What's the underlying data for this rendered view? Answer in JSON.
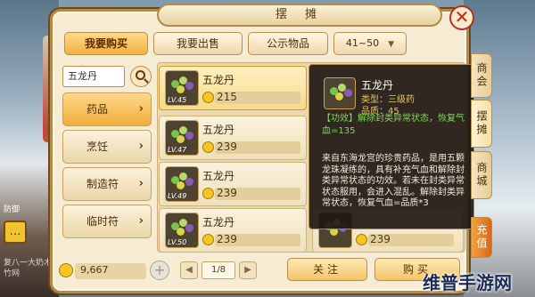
{
  "window": {
    "title": "摆 摊",
    "close_icon": "close-icon"
  },
  "tabs": [
    {
      "label": "我要购买",
      "active": true
    },
    {
      "label": "我要出售",
      "active": false
    },
    {
      "label": "公示物品",
      "active": false
    }
  ],
  "level_filter": {
    "value": "41~50"
  },
  "search": {
    "value": "五龙丹"
  },
  "categories": [
    {
      "label": "药品",
      "active": true
    },
    {
      "label": "烹饪",
      "active": false
    },
    {
      "label": "制造符",
      "active": false
    },
    {
      "label": "临时符",
      "active": false
    }
  ],
  "items": [
    {
      "name": "五龙丹",
      "level": "LV.45",
      "price": "215",
      "selected": true
    },
    {
      "name": "五龙丹",
      "level": "LV.47",
      "price": "239",
      "selected": false
    },
    {
      "name": "五龙丹",
      "level": "LV.49",
      "price": "239",
      "selected": false
    },
    {
      "name": "五龙丹",
      "level": "LV.50",
      "price": "239",
      "selected": false
    },
    {
      "price": "239"
    }
  ],
  "tooltip": {
    "name": "五龙丹",
    "type": "类型：三级药",
    "grade": "品质：45",
    "effect": "【功效】解除封类异常状态，恢复气血=135",
    "description": "来自东海龙宫的珍贵药品，是用五颗龙珠凝练的，具有补充气血和解除封类异常状态的功效。若未在封类异常状态服用，会进入混乱。解除封类异常状态，恢复气血=品质*3"
  },
  "side_tabs": [
    "商会",
    "摆摊",
    "商城",
    "充值"
  ],
  "bottom": {
    "money": "9,667",
    "page": "1/8",
    "prev_icon": "◀",
    "next_icon": "▶",
    "follow_label": "关注",
    "buy_label": "购买"
  },
  "status": {
    "left_label": "防御",
    "side_text": "复八一大奶木竹网"
  },
  "watermark": "维普手游网"
}
